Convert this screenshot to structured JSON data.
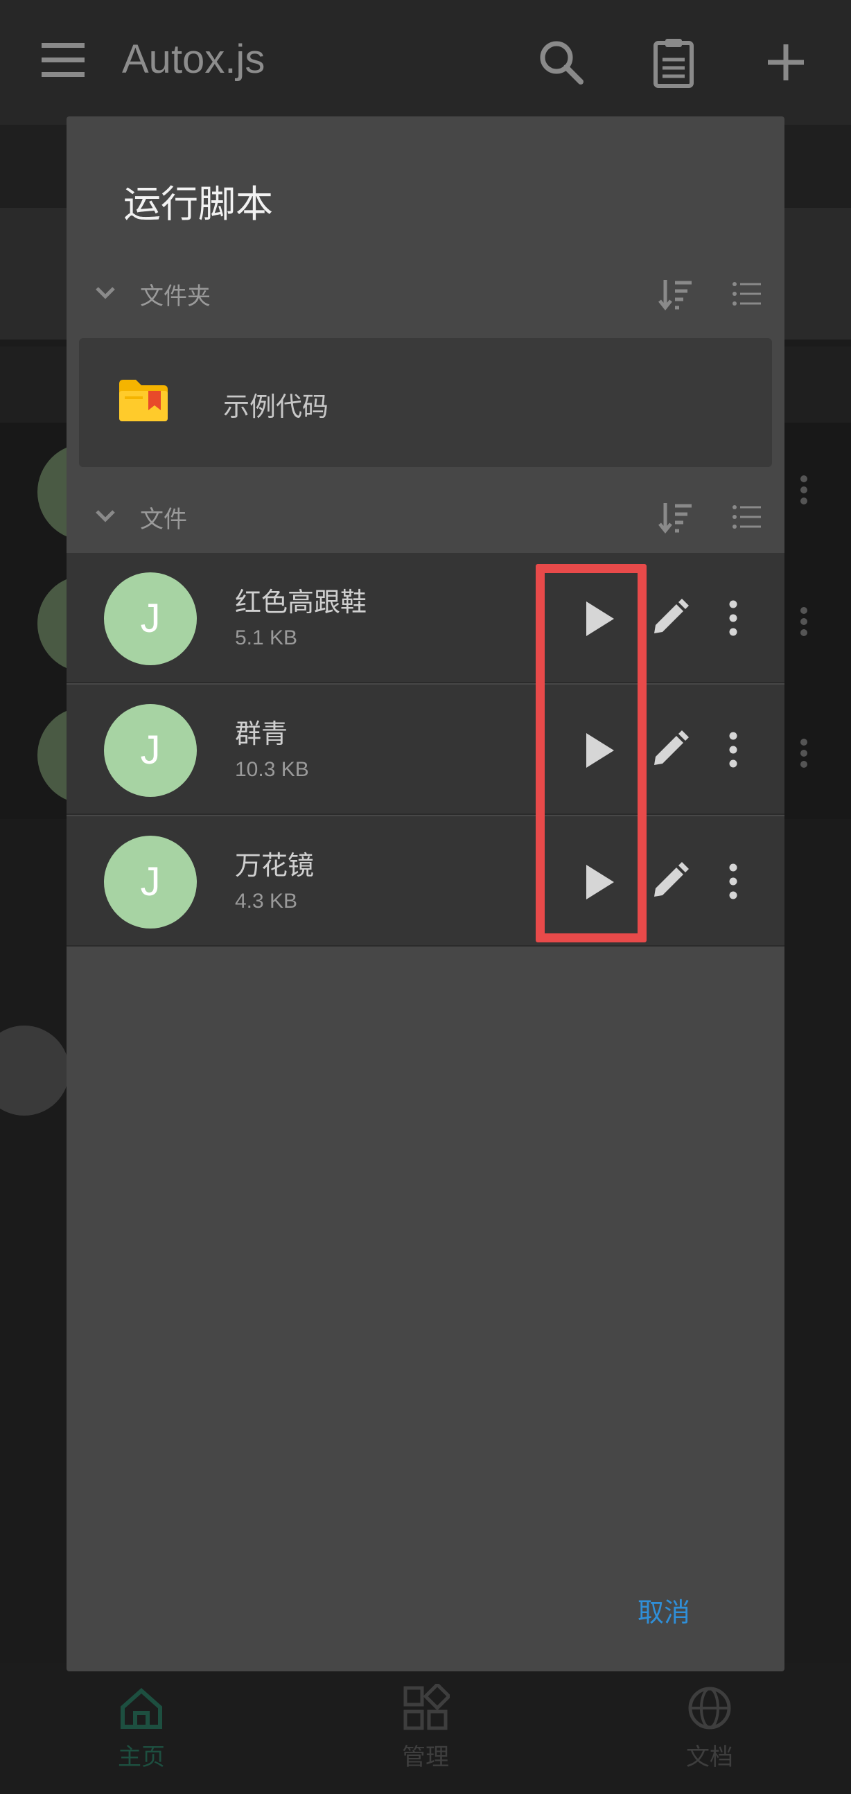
{
  "app": {
    "title": "Autox.js",
    "icons": [
      "menu-icon",
      "search-icon",
      "clipboard-icon",
      "plus-icon"
    ]
  },
  "bottom_nav": {
    "items": [
      {
        "label": "主页",
        "icon": "home-icon",
        "active": true
      },
      {
        "label": "管理",
        "icon": "grid-icon",
        "active": false
      },
      {
        "label": "文档",
        "icon": "globe-icon",
        "active": false
      }
    ]
  },
  "dialog": {
    "title": "运行脚本",
    "folders_section": {
      "label": "文件夹"
    },
    "folders": [
      {
        "name": "示例代码",
        "icon": "folder-bookmark-icon"
      }
    ],
    "files_section": {
      "label": "文件"
    },
    "files": [
      {
        "avatar": "J",
        "name": "红色高跟鞋",
        "size": "5.1 KB"
      },
      {
        "avatar": "J",
        "name": "群青",
        "size": "10.3 KB"
      },
      {
        "avatar": "J",
        "name": "万花镜",
        "size": "4.3 KB"
      }
    ],
    "cancel_label": "取消"
  },
  "colors": {
    "dialog_bg": "#474747",
    "row_bg": "#353535",
    "avatar_bg": "#a7d3a3",
    "accent": "#2f8fd8",
    "highlight": "#e84a4a"
  }
}
